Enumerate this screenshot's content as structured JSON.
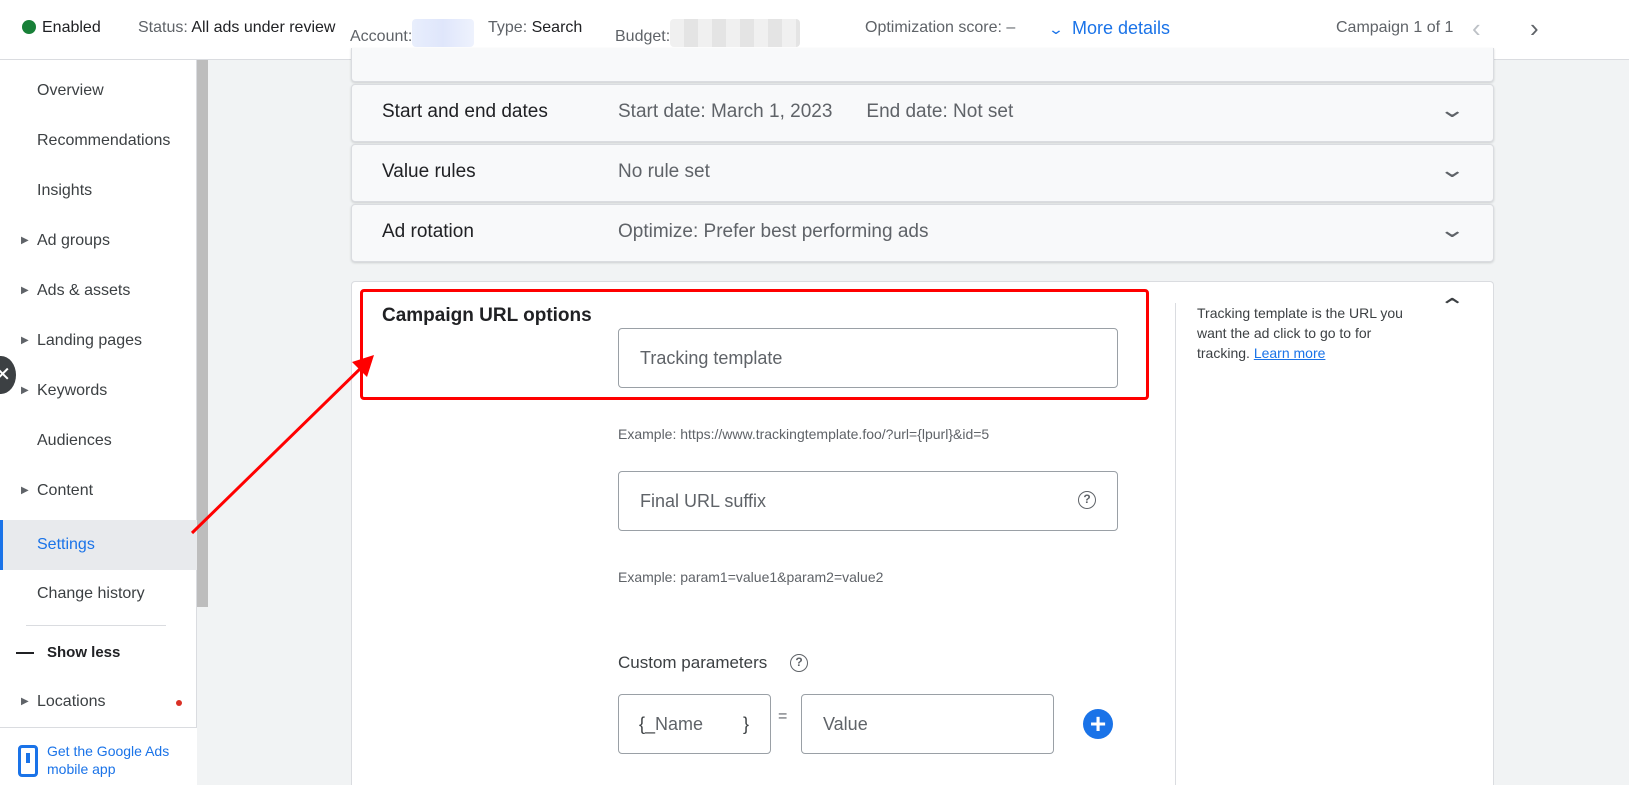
{
  "topbar": {
    "status_state": "Enabled",
    "status_label": "Status:",
    "status_value": "All ads under review",
    "account_label": "Account:",
    "type_label": "Type:",
    "type_value": "Search",
    "budget_label": "Budget:",
    "opt_score": "Optimization score: –",
    "more_details": "More details",
    "campaign_counter": "Campaign 1 of 1"
  },
  "sidebar": {
    "items": [
      {
        "label": "Overview"
      },
      {
        "label": "Recommendations"
      },
      {
        "label": "Insights"
      },
      {
        "label": "Ad groups"
      },
      {
        "label": "Ads & assets"
      },
      {
        "label": "Landing pages"
      },
      {
        "label": "Keywords"
      },
      {
        "label": "Audiences"
      },
      {
        "label": "Content"
      },
      {
        "label": "Settings"
      },
      {
        "label": "Change history"
      }
    ],
    "show_less": "Show less",
    "locations": "Locations",
    "app_promo": "Get the Google Ads mobile app"
  },
  "cards": {
    "dates": {
      "title": "Start and end dates",
      "start": "Start date: March 1, 2023",
      "end": "End date: Not set"
    },
    "value_rules": {
      "title": "Value rules",
      "summary": "No rule set"
    },
    "ad_rotation": {
      "title": "Ad rotation",
      "summary": "Optimize: Prefer best performing ads"
    }
  },
  "url_options": {
    "title": "Campaign URL options",
    "tracking_placeholder": "Tracking template",
    "tracking_example": "Example: https://www.trackingtemplate.foo/?url={lpurl}&id=5",
    "suffix_placeholder": "Final URL suffix",
    "suffix_example": "Example: param1=value1&param2=value2",
    "custom_params_label": "Custom parameters",
    "name_prefix": "{_",
    "name_placeholder": "Name",
    "name_suffix": "}",
    "equals": "=",
    "value_placeholder": "Value",
    "help_text": "Tracking template is the URL you want the ad click to go to for tracking.",
    "learn_more": "Learn more"
  },
  "colors": {
    "accent": "#1a73e8",
    "enabled": "#188038",
    "annotation": "#ff0000"
  }
}
